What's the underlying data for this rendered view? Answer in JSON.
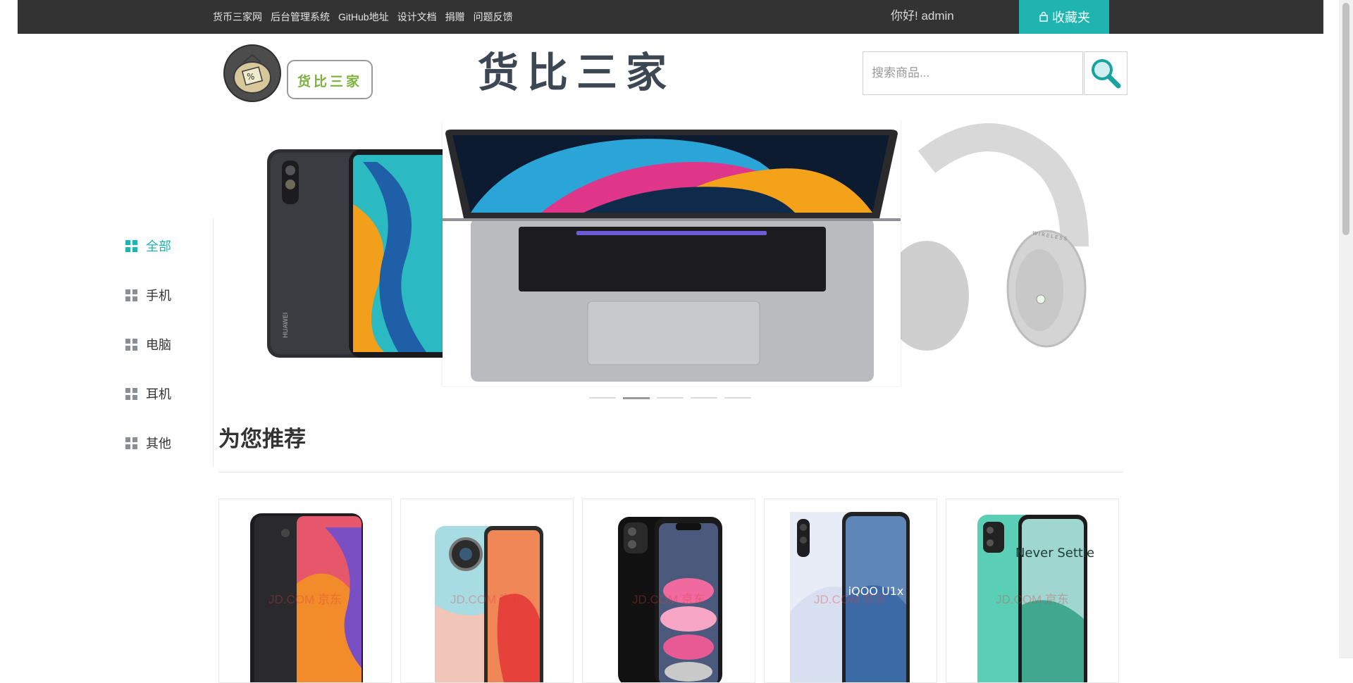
{
  "topnav": {
    "links": [
      "货币三家网",
      "后台管理系统",
      "GitHub地址",
      "设计文档",
      "捐赠",
      "问题反馈"
    ],
    "greeting": "你好!  admin",
    "favorites_label": "收藏夹"
  },
  "header": {
    "logo_text": "货比三家",
    "logo_badge": "%",
    "brand_title": "货比三家",
    "search_placeholder": "搜索商品..."
  },
  "sidebar": {
    "items": [
      {
        "label": "全部",
        "active": true
      },
      {
        "label": "手机",
        "active": false
      },
      {
        "label": "电脑",
        "active": false
      },
      {
        "label": "耳机",
        "active": false
      },
      {
        "label": "其他",
        "active": false
      }
    ]
  },
  "carousel": {
    "slides": [
      "HUAWEI",
      "",
      "WIRELESS"
    ],
    "active_index": 1,
    "dot_count": 5
  },
  "recommend": {
    "title": "为您推荐",
    "watermark": "JD.COM 京东",
    "products": [
      {
        "id": "p1",
        "screen_text": ""
      },
      {
        "id": "p2",
        "screen_text": ""
      },
      {
        "id": "p3",
        "screen_text": ""
      },
      {
        "id": "p4",
        "screen_text": "iQOO U1x"
      },
      {
        "id": "p5",
        "screen_text": "Never Settle"
      }
    ]
  },
  "colors": {
    "accent": "#1fb4b0",
    "topbar": "#333333",
    "brand_text": "#3d4753"
  }
}
